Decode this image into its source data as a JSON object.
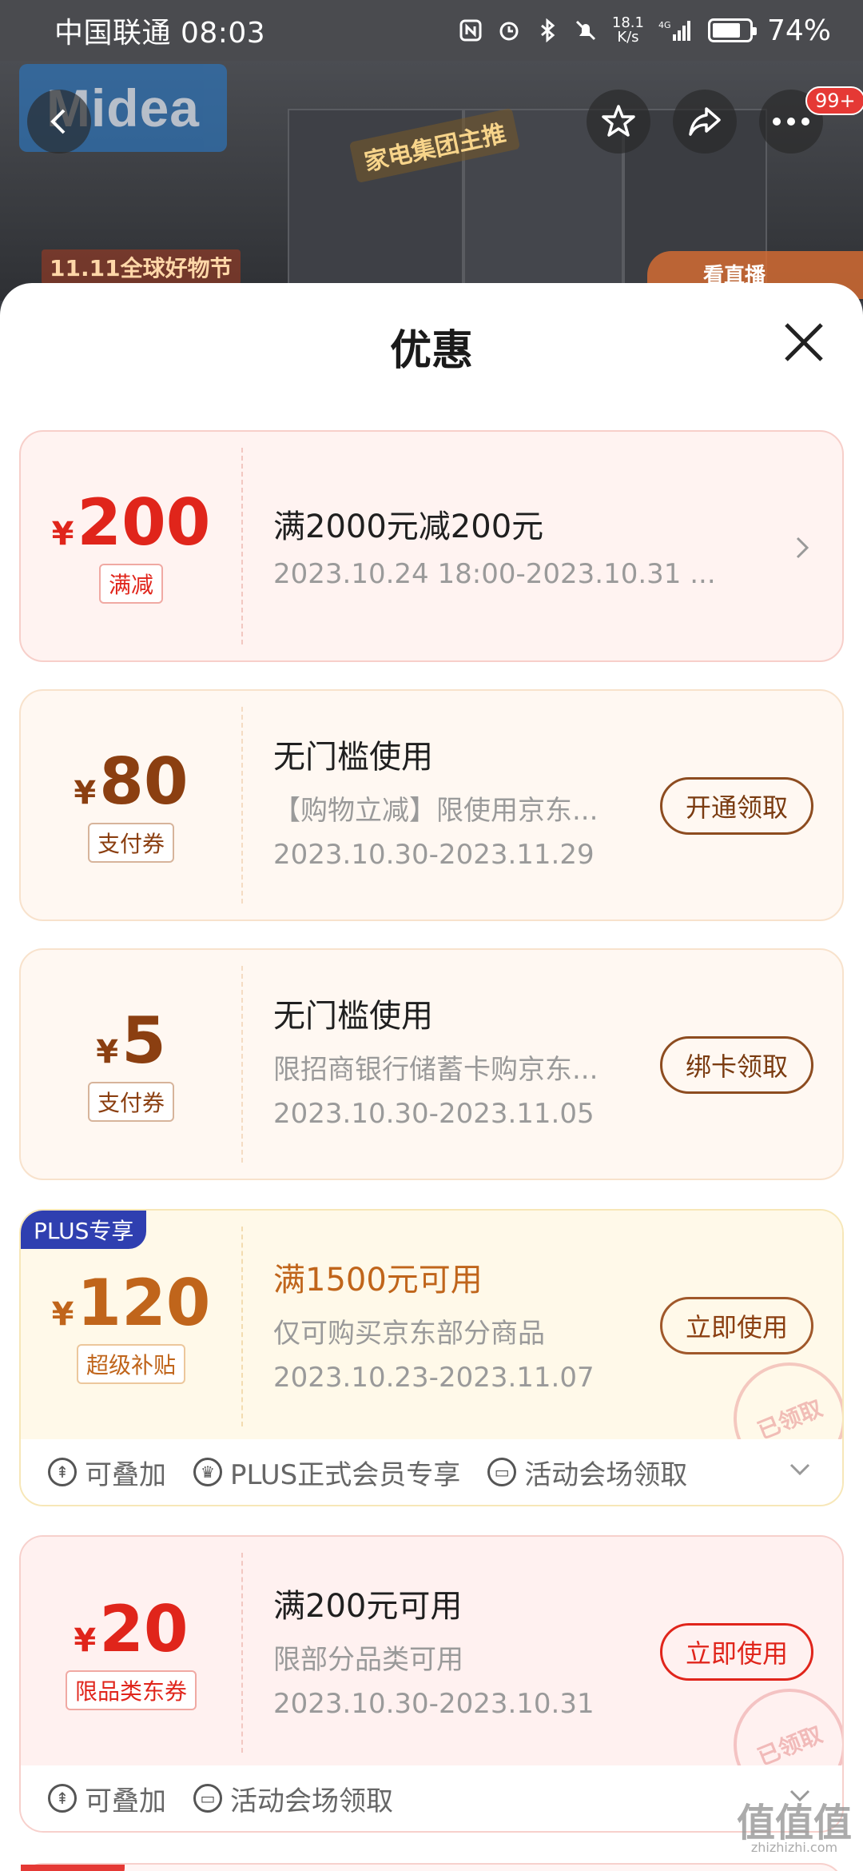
{
  "status_bar": {
    "carrier_time": "中国联通 08:03",
    "net_speed": "18.1",
    "net_unit": "K/s",
    "signal_label": "4G",
    "battery": "74%"
  },
  "hero": {
    "brand": "Midea",
    "crown_tag": "家电集团主推",
    "promo_left": "11.11全球好物节",
    "promo_right": "看直播",
    "badge": "99+"
  },
  "sheet": {
    "title": "优惠"
  },
  "coupons": [
    {
      "yen": "¥",
      "amount": "200",
      "type_tag": "满减",
      "headline": "满2000元减200元",
      "dates": "2023.10.24 18:00-2023.10.31 ..."
    },
    {
      "yen": "¥",
      "amount": "80",
      "type_tag": "支付券",
      "headline": "无门槛使用",
      "subline": "【购物立减】限使用京东...",
      "dates": "2023.10.30-2023.11.29",
      "action": "开通领取"
    },
    {
      "yen": "¥",
      "amount": "5",
      "type_tag": "支付券",
      "headline": "无门槛使用",
      "subline": "限招商银行储蓄卡购京东...",
      "dates": "2023.10.30-2023.11.05",
      "action": "绑卡领取"
    },
    {
      "badge": "PLUS专享",
      "yen": "¥",
      "amount": "120",
      "type_tag": "超级补贴",
      "headline": "满1500元可用",
      "subline": "仅可购买京东部分商品",
      "dates": "2023.10.23-2023.11.07",
      "action": "立即使用",
      "stamp": "已领取",
      "features": [
        "可叠加",
        "PLUS正式会员专享",
        "活动会场领取"
      ]
    },
    {
      "yen": "¥",
      "amount": "20",
      "type_tag": "限品类东券",
      "headline": "满200元可用",
      "subline": "限部分品类可用",
      "dates": "2023.10.30-2023.10.31",
      "action": "立即使用",
      "stamp": "已领取",
      "features": [
        "可叠加",
        "活动会场领取"
      ]
    }
  ],
  "watermark": {
    "main": "值值值",
    "sub": "zhizhizhi.com"
  },
  "colors": {
    "red": "#e0251b",
    "brown": "#8b3f11",
    "orange": "#c0651b",
    "plus_blue": "#2f3fb0"
  }
}
